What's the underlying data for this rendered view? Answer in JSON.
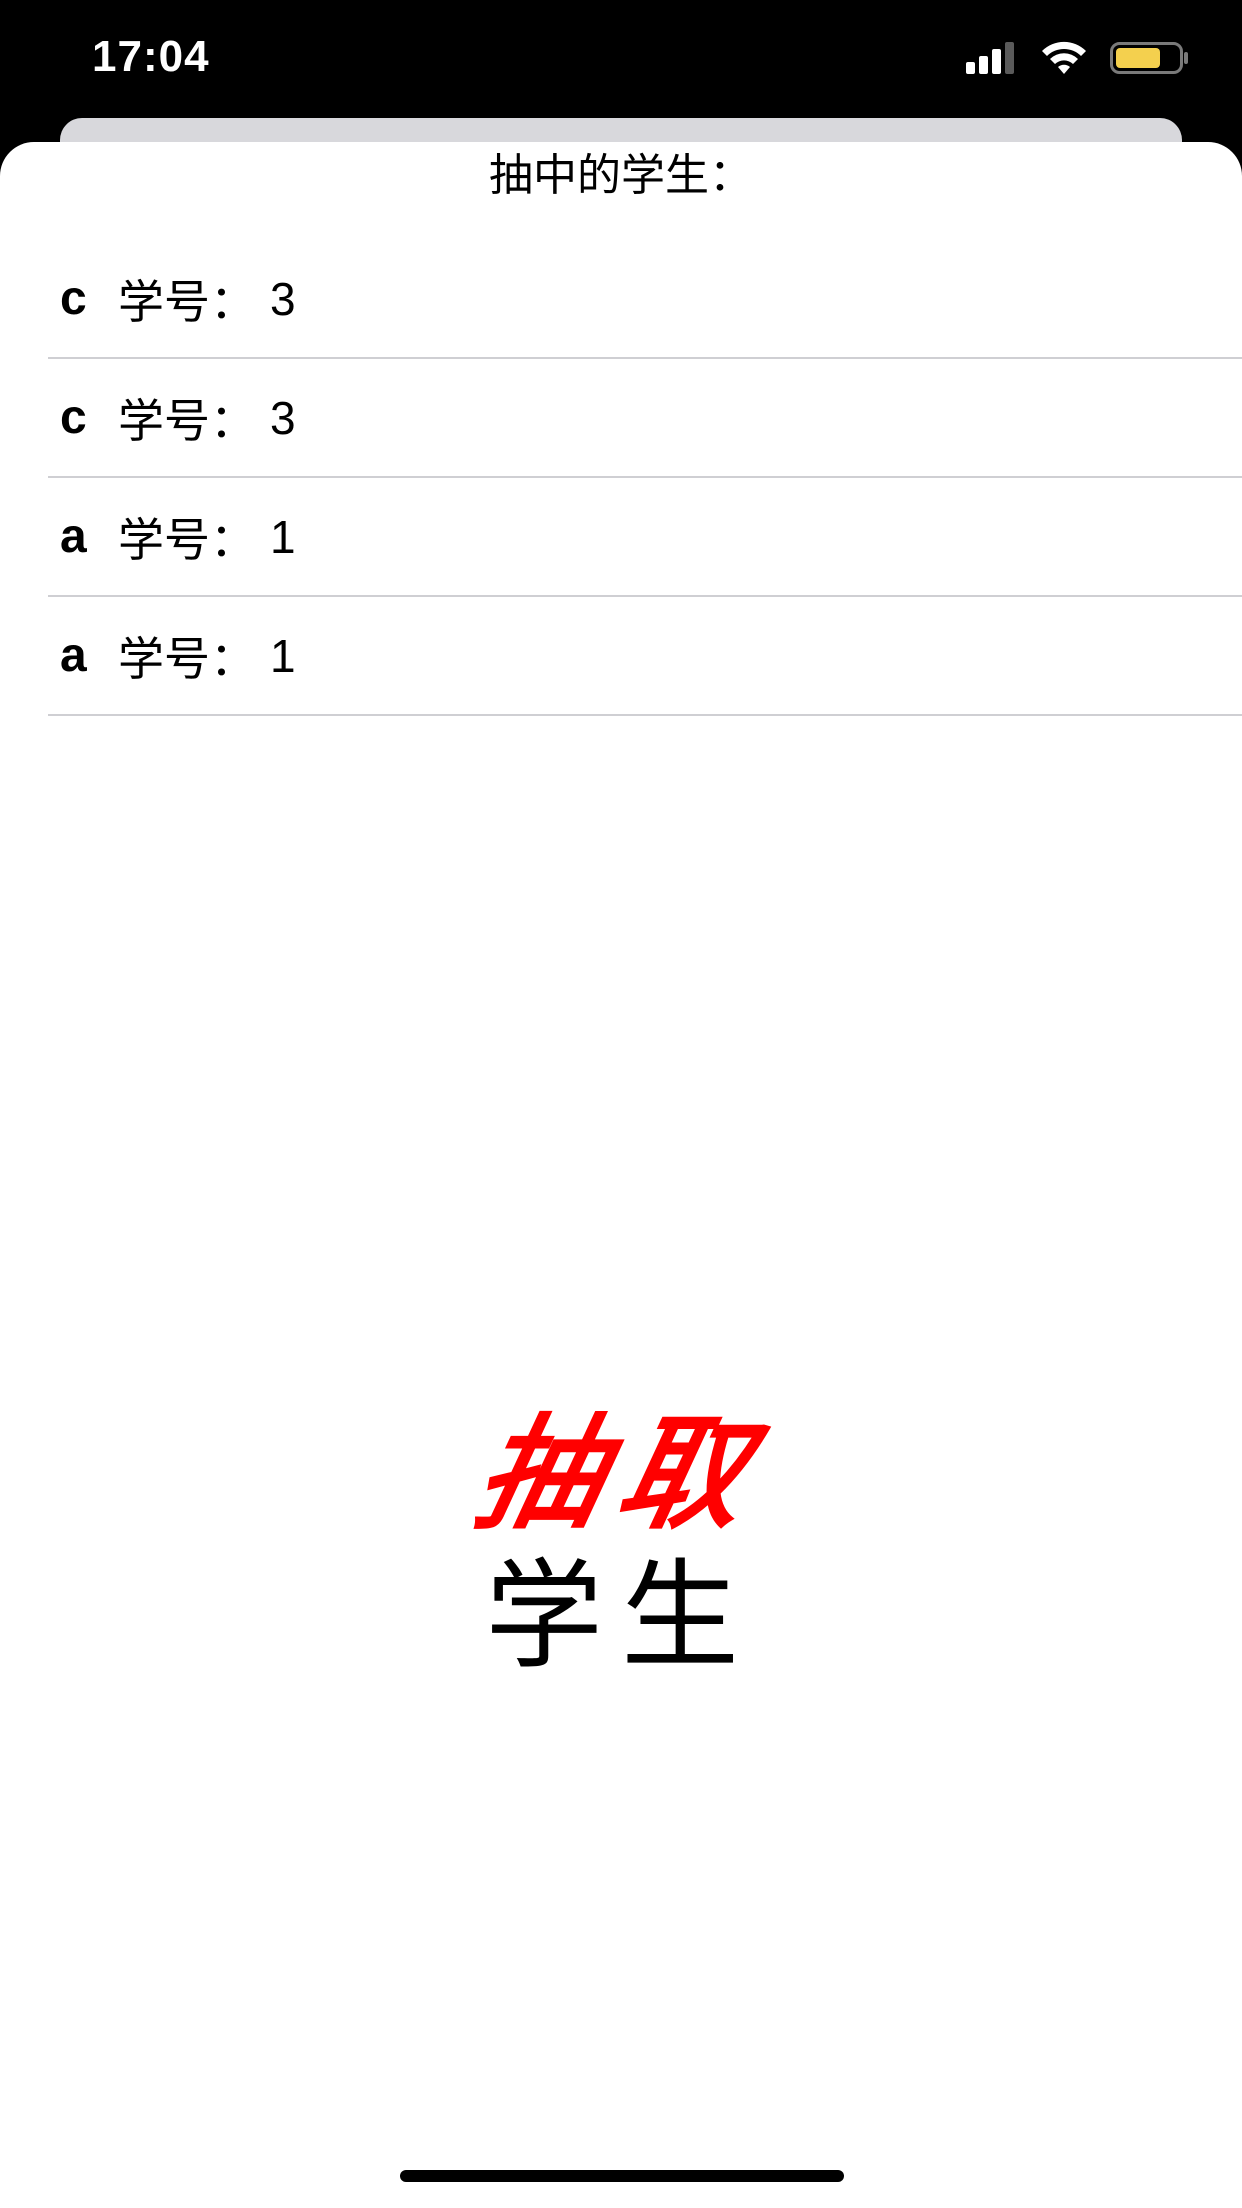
{
  "status_bar": {
    "time": "17:04",
    "icons": [
      "signal-icon",
      "wifi-icon",
      "battery-icon"
    ],
    "battery_color": "#f4d04e"
  },
  "sheet": {
    "title": "抽中的学生："
  },
  "students": [
    {
      "name": "c",
      "label": "学号：",
      "id": "3"
    },
    {
      "name": "c",
      "label": "学号：",
      "id": "3"
    },
    {
      "name": "a",
      "label": "学号：",
      "id": "1"
    },
    {
      "name": "a",
      "label": "学号：",
      "id": "1"
    }
  ],
  "draw_button": {
    "main_label": "抽取",
    "sub_label": "学生",
    "main_color": "#ff0000"
  }
}
